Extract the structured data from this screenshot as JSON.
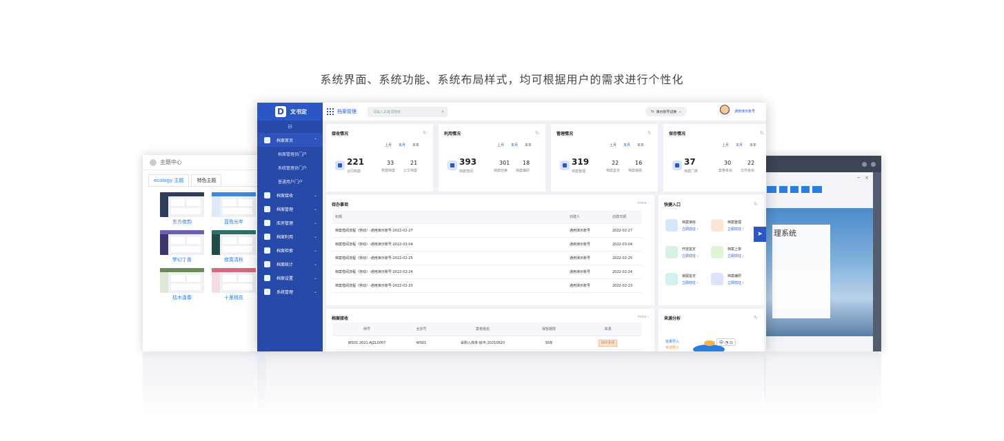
{
  "headline": "系统界面、系统功能、系统布局样式，均可根据用户的需求进行个性化",
  "theme_panel": {
    "title": "主题中心",
    "tabs": [
      "ecology 主题",
      "特色主题"
    ],
    "themes": [
      {
        "label": "东方夜韵",
        "bar": "#2d3c5a",
        "side": "#2d3c5a"
      },
      {
        "label": "蓝色光年",
        "bar": "#3f8ad8",
        "side": "#dfe8f5"
      },
      {
        "label": "梦幻丁香",
        "bar": "#6c5fb5",
        "side": "#3d3570"
      },
      {
        "label": "寂寞清秋",
        "bar": "#2f6f6a",
        "side": "#1f4b48"
      },
      {
        "label": "枯木逢春",
        "bar": "#6f8a5a",
        "side": "#dfe7d7"
      },
      {
        "label": "十里桃花",
        "bar": "#d66b7f",
        "side": "#f3dde2"
      }
    ]
  },
  "right_panel": {
    "system_text": "理系统"
  },
  "app": {
    "logo_text": "文书定",
    "module_title": "档案管理",
    "search_placeholder": "请输入关键词搜索",
    "switch_label": "演示账号切换",
    "user_name": "通用演示账号"
  },
  "sidebar": {
    "collapse_glyph": "⊟",
    "items": [
      {
        "label": "档案首页",
        "open": true
      },
      {
        "label": "档案管理员门户",
        "sub": true
      },
      {
        "label": "系统管理员门户",
        "sub": true
      },
      {
        "label": "普通用户门户",
        "sub": true
      },
      {
        "label": "档案接收"
      },
      {
        "label": "档案管理"
      },
      {
        "label": "库房管理"
      },
      {
        "label": "档案利用"
      },
      {
        "label": "档案检索"
      },
      {
        "label": "档案统计"
      },
      {
        "label": "档案设置"
      },
      {
        "label": "系统管理"
      }
    ]
  },
  "periods": [
    "上月",
    "本月",
    "本年"
  ],
  "stats": [
    {
      "title": "接收情况",
      "big": "221",
      "big_label": "合同档案",
      "n1": "33",
      "l1": "党建档案",
      "n2": "21",
      "l2": "公文档案"
    },
    {
      "title": "利用情况",
      "big": "393",
      "big_label": "档案借阅",
      "n1": "301",
      "l1": "档案检索",
      "n2": "18",
      "l2": "档案编研"
    },
    {
      "title": "管理情况",
      "big": "319",
      "big_label": "档案整理",
      "n1": "22",
      "l1": "档案鉴定",
      "n2": "16",
      "l2": "档案销毁"
    },
    {
      "title": "保存情况",
      "big": "37",
      "big_label": "档案门类",
      "n1": "30",
      "l1": "案卷条目",
      "n2": "22",
      "l2": "文件条目"
    }
  ],
  "todo": {
    "title": "待办事项",
    "more": "more ›",
    "columns": [
      "标题",
      "创建人",
      "创建日期"
    ],
    "rows": [
      [
        "档案借阅流程（劳动）-通用演示账号-2022-02-27",
        "通用演示账号",
        "2022-02-27"
      ],
      [
        "档案借阅流程（劳动）-通用演示账号-2022-03-04",
        "通用演示账号",
        "2022-03-04"
      ],
      [
        "档案借阅流程（劳动）-通用演示账号-2022-02-25",
        "通用演示账号",
        "2022-02-25"
      ],
      [
        "档案借阅流程（劳动）-通用演示账号-2022-02-24",
        "通用演示账号",
        "2022-02-24"
      ],
      [
        "档案借阅流程（劳动）-通用演示账号-2022-02-23",
        "通用演示账号",
        "2022-02-23"
      ]
    ]
  },
  "quick": {
    "title": "快捷入口",
    "link_label": "立即前往 ›",
    "items": [
      {
        "name": "档案接收",
        "color": "#d6e6fb"
      },
      {
        "name": "档案整理",
        "color": "#fde5d3"
      },
      {
        "name": "开放鉴定",
        "color": "#d7f2e1"
      },
      {
        "name": "档案上架",
        "color": "#e3f3d6"
      },
      {
        "name": "销毁鉴定",
        "color": "#d3f1f0"
      },
      {
        "name": "档案编研",
        "color": "#dbe4fb"
      }
    ]
  },
  "receive": {
    "title": "档案接收",
    "more": "more ›",
    "columns": [
      "档号",
      "全宗号",
      "案卷题名",
      "保管期限",
      "来源"
    ],
    "row": [
      "WS01-2021-AJZL0007",
      "WS01",
      "采购入库单-徐平-20210620",
      "30年",
      "ERP系统"
    ]
  },
  "source": {
    "title": "来源分析",
    "labels": [
      "批量导入",
      "手动导入"
    ],
    "ctrl": "中 ◔ ⊙"
  }
}
